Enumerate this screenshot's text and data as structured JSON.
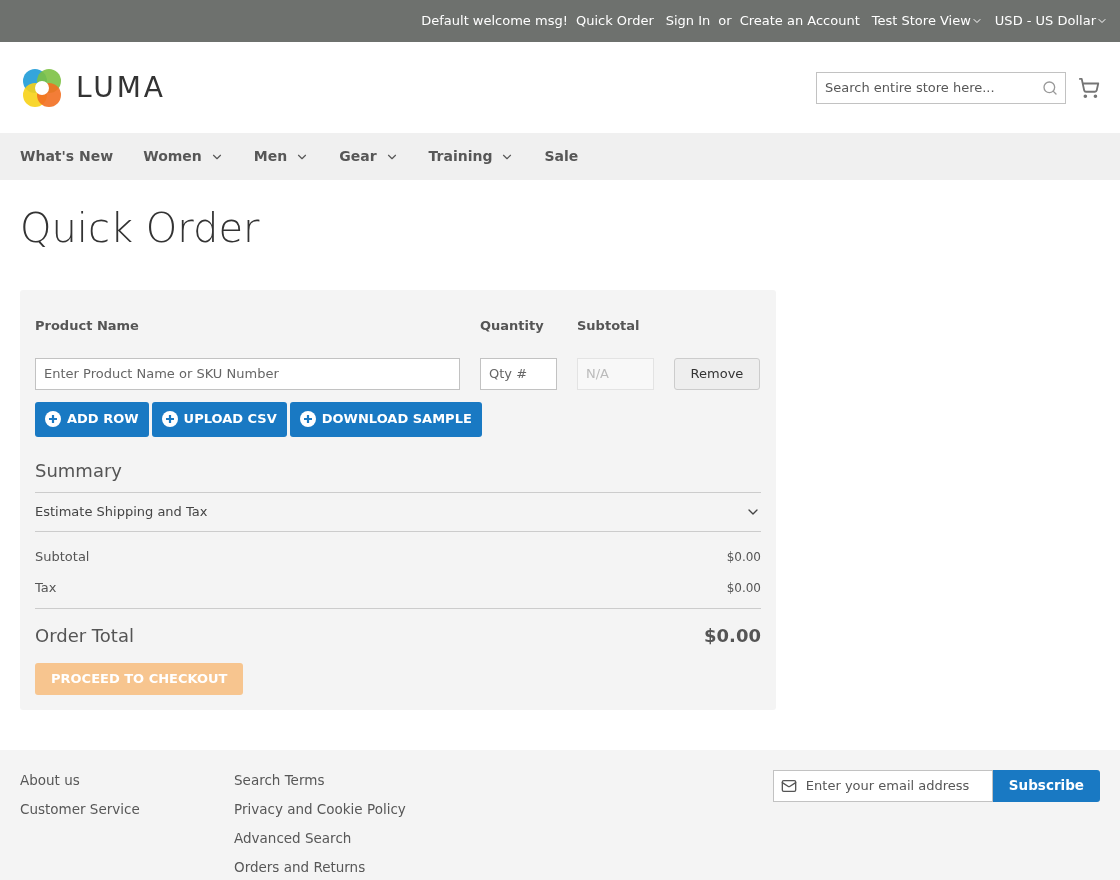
{
  "top_bar": {
    "links": [
      {
        "label": "Default welcome msg!",
        "kind": "text"
      },
      {
        "label": "Quick Order",
        "kind": "link"
      },
      {
        "label": "Sign In",
        "kind": "link"
      },
      {
        "label": "or",
        "kind": "text"
      },
      {
        "label": "Create an Account",
        "kind": "link"
      },
      {
        "label": "Test Store View",
        "kind": "dropdown"
      },
      {
        "label": "USD - US Dollar",
        "kind": "dropdown"
      }
    ]
  },
  "header": {
    "logo": "LUMA",
    "search": {
      "placeholder": "Search entire store here..."
    }
  },
  "nav": [
    {
      "label": "What's New",
      "has_menu": false
    },
    {
      "label": "Women",
      "has_menu": true
    },
    {
      "label": "Men",
      "has_menu": true
    },
    {
      "label": "Gear",
      "has_menu": true
    },
    {
      "label": "Training",
      "has_menu": true
    },
    {
      "label": "Sale",
      "has_menu": false
    }
  ],
  "page_title": "Quick Order",
  "order_form": {
    "columns": [
      "Product Name",
      "Quantity",
      "Subtotal"
    ],
    "rows": [
      {
        "product": {
          "placeholder": "Enter Product Name or SKU Number"
        },
        "qty": {
          "placeholder": "Qty #"
        },
        "subtotal": {
          "placeholder": "N/A"
        },
        "remove": "Remove"
      }
    ],
    "actions": [
      "ADD ROW",
      "UPLOAD CSV",
      "DOWNLOAD SAMPLE"
    ]
  },
  "summary": {
    "title": "Summary",
    "estimate": {
      "label": "Estimate Shipping and Tax",
      "expanded": false
    },
    "lines": [
      {
        "label": "Subtotal",
        "value": "$0.00"
      },
      {
        "label": "Tax",
        "value": "$0.00"
      }
    ],
    "total": {
      "label": "Order Total",
      "value": "$0.00"
    },
    "checkout": {
      "label": "PROCEED TO CHECKOUT",
      "disabled": true
    }
  },
  "footer": {
    "column_1": [
      "About us",
      "Customer Service"
    ],
    "column_2": [
      "Search Terms",
      "Privacy and Cookie Policy",
      "Advanced Search",
      "Orders and Returns"
    ],
    "newsletter": {
      "placeholder": "Enter your email address",
      "button": "Subscribe"
    }
  }
}
